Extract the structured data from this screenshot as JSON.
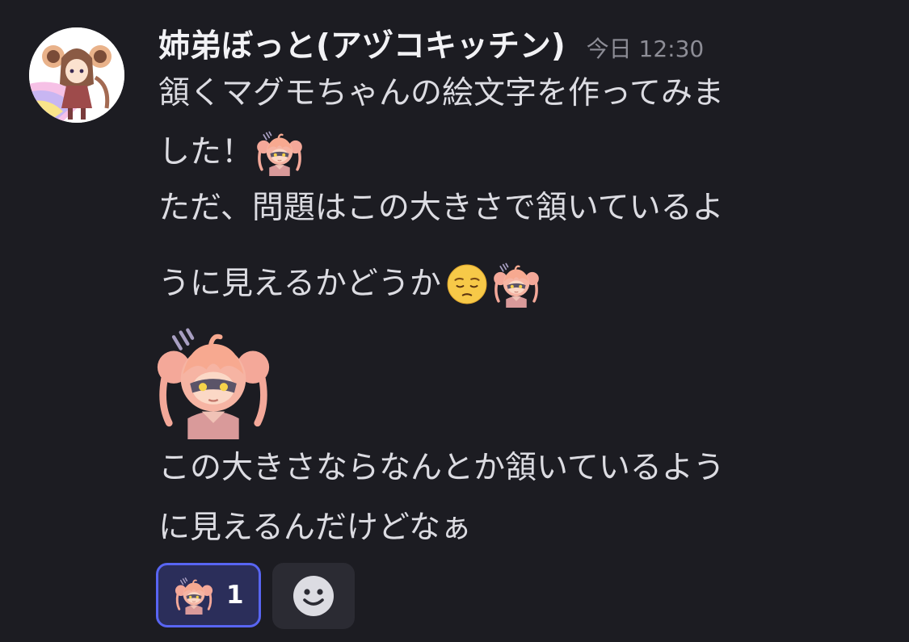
{
  "message": {
    "author": "姉弟ぼっと(アヅコキッチン)",
    "timestamp": "今日 12:30",
    "lines": [
      "頷くマグモちゃんの絵文字を作ってみま",
      "した！",
      "ただ、問題はこの大きさで頷いているよ",
      "うに見えるかどうか",
      "この大きさならなんとか頷いているよう",
      "に見えるんだけどなぁ"
    ]
  },
  "emojis": {
    "custom": "magumo-nod-emoji",
    "unicode": "pensive-face-emoji"
  },
  "reactions": [
    {
      "emoji": "magumo-nod-emoji",
      "count": "1"
    }
  ],
  "add_reaction_icon": "smiley-add-reaction-icon",
  "colors": {
    "background": "#1c1c22",
    "accent": "#5865f2",
    "reaction_bg": "#2b2e5a",
    "hair": "#f4a899",
    "text": "#dcdce2",
    "muted": "#8d8d96"
  }
}
